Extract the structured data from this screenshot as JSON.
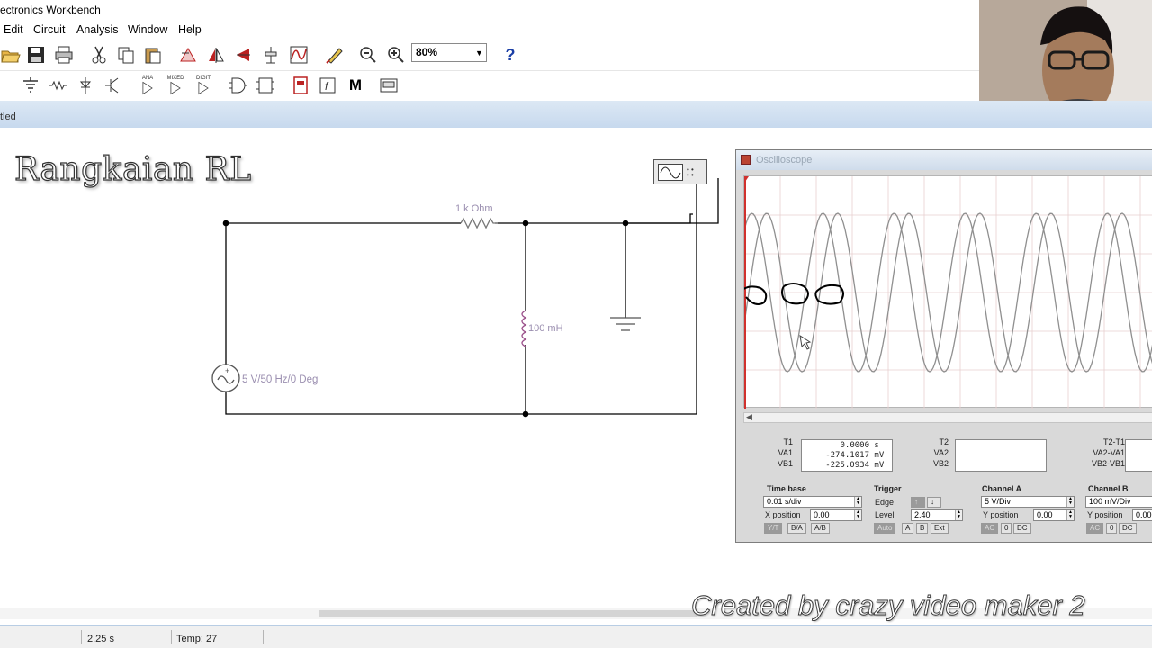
{
  "app": {
    "title": "ectronics Workbench",
    "document_title": "tled"
  },
  "menu": [
    "Edit",
    "Circuit",
    "Analysis",
    "Window",
    "Help"
  ],
  "toolbar": {
    "zoom_value": "80%",
    "help_label": "?",
    "mode_label": "M",
    "mixed_label": "MIXED",
    "digit_label": "DIGIT",
    "ana_label": "ANA"
  },
  "overlay": {
    "title": "Rangkaian RL",
    "watermark": "Created by crazy video maker 2"
  },
  "circuit": {
    "resistor_label": "1 k Ohm",
    "inductor_label": "100 mH",
    "source_label": "5 V/50 Hz/0 Deg"
  },
  "oscilloscope": {
    "title": "Oscilloscope",
    "readout": {
      "t1_label": "T1",
      "va1_label": "VA1",
      "vb1_label": "VB1",
      "t1_value": "0.0000",
      "t1_unit": "s",
      "va1_value": "-274.1017",
      "va1_unit": "mV",
      "vb1_value": "-225.0934",
      "vb1_unit": "mV",
      "t2_label": "T2",
      "va2_label": "VA2",
      "vb2_label": "VB2",
      "t2t1_label": "T2-T1",
      "va2va1_label": "VA2-VA1",
      "vb2vb1_label": "VB2-VB1"
    },
    "timebase": {
      "title": "Time base",
      "value": "0.01 s/div",
      "xpos_label": "X position",
      "xpos_value": "0.00",
      "btns": [
        "Y/T",
        "B/A",
        "A/B"
      ]
    },
    "trigger": {
      "title": "Trigger",
      "edge_label": "Edge",
      "level_label": "Level",
      "level_value": "2.40",
      "btns": [
        "Auto",
        "A",
        "B",
        "Ext"
      ]
    },
    "channel_a": {
      "title": "Channel A",
      "value": "5 V/Div",
      "ypos_label": "Y position",
      "ypos_value": "0.00",
      "btns": [
        "AC",
        "0",
        "DC"
      ]
    },
    "channel_b": {
      "title": "Channel B",
      "value": "100 mV/Div",
      "ypos_label": "Y position",
      "ypos_value": "0.00",
      "btns": [
        "AC",
        "0",
        "DC"
      ]
    }
  },
  "status": {
    "time": "2.25 s",
    "temp": "Temp:  27"
  },
  "colors": {
    "wire": "#000000",
    "trace": "#8f8f8f",
    "annotation": "#000000",
    "cursor": "#d0312d",
    "label": "#9b8fb0"
  }
}
